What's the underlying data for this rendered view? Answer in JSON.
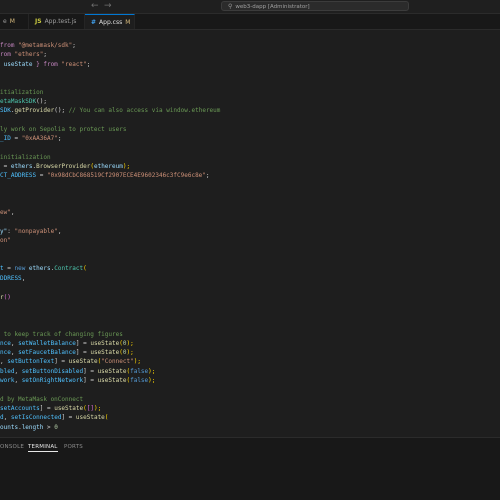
{
  "titlebar": {
    "back_icon": "arrow-left-icon",
    "forward_icon": "arrow-right-icon",
    "search_text": "web3-dapp [Administrator]"
  },
  "tabs": [
    {
      "label": "e",
      "modified": "M",
      "icon": "",
      "active": false
    },
    {
      "label": "App.test.js",
      "modified": "",
      "icon": "JS",
      "icon_color": "#cbcb41",
      "active": false
    },
    {
      "label": "App.css",
      "modified": "M",
      "icon": "#",
      "icon_color": "#42a5f5",
      "active": true
    }
  ],
  "code": {
    "l01": {
      "a": "from ",
      "b": "\"@metamask/sdk\"",
      "c": ";"
    },
    "l02": {
      "a": "rom ",
      "b": "\"ethers\"",
      "c": ";"
    },
    "l03": {
      "a": " useState ",
      "b": "} from ",
      "c": "\"react\"",
      "d": ";"
    },
    "l05": {
      "a": "itialization"
    },
    "l06": {
      "a": "etaMaskSDK",
      "b": "();"
    },
    "l07": {
      "a": "SDK",
      "b": ".",
      "c": "getProvider",
      "d": "(); ",
      "e": "// You can also access via window.ethereum"
    },
    "l09": {
      "a": "ly work on Sepolia to protect users"
    },
    "l10": {
      "a": "_ID",
      "b": " = ",
      "c": "\"0xAA36A7\"",
      "d": ";"
    },
    "l12": {
      "a": "initialization"
    },
    "l13": {
      "a": " = ",
      "b": "ethers",
      "c": ".",
      "d": "BrowserProvider",
      "e": "(",
      "f": "ethereum",
      "g": ");"
    },
    "l14": {
      "a": "CT_ADDRESS",
      "b": " = ",
      "c": "\"0x98dCbC868519Cf2907ECE4E9602346c3fC9e6c8e\"",
      "d": ";"
    },
    "l18": {
      "a": "ew\"",
      "b": ","
    },
    "l21": {
      "a": "y\"",
      "b": ": ",
      "c": "\"nonpayable\"",
      "d": ","
    },
    "l22": {
      "a": "on\""
    },
    "l25": {
      "a": "t",
      "b": " = ",
      "c": "new ",
      "d": "ethers",
      "e": ".",
      "f": "Contract",
      "g": "("
    },
    "l26": {
      "a": "DDRESS",
      "b": ","
    },
    "l29": {
      "a": "r",
      "b": "()"
    },
    "l33": {
      "a": " to keep track of changing figures"
    },
    "l34": {
      "a": "nce",
      "b": ", ",
      "c": "setWalletBalance",
      "d": "] = ",
      "e": "useState",
      "f": "(",
      "g": "0",
      "h": ");"
    },
    "l35": {
      "a": "nce",
      "b": ", ",
      "c": "setFaucetBalance",
      "d": "] = ",
      "e": "useState",
      "f": "(",
      "g": "0",
      "h": ");"
    },
    "l36": {
      "a": ", ",
      "b": "setButtonText",
      "c": "] = ",
      "d": "useState",
      "e": "(",
      "f": "\"Connect\"",
      "g": ");"
    },
    "l37": {
      "a": "bled",
      "b": ", ",
      "c": "setButtonDisabled",
      "d": "] = ",
      "e": "useState",
      "f": "(",
      "g": "false",
      "h": ");"
    },
    "l38": {
      "a": "work",
      "b": ", ",
      "c": "setOnRightNetwork",
      "d": "] = ",
      "e": "useState",
      "f": "(",
      "g": "false",
      "h": ");"
    },
    "l40": {
      "a": "d by MetaMask onConnect"
    },
    "l41": {
      "a": "setAccounts",
      "b": "] = ",
      "c": "useState",
      "d": "(",
      "e": "[]",
      "f": ");"
    },
    "l42": {
      "a": "d",
      "b": ", ",
      "c": "setIsConnected",
      "d": "] = ",
      "e": "useState",
      "f": "("
    },
    "l43": {
      "a": "ounts",
      "b": ".",
      "c": "length",
      "d": " > ",
      "e": "0"
    }
  },
  "panel": {
    "tabs": [
      "ONSOLE",
      "TERMINAL",
      "PORTS"
    ],
    "active": "TERMINAL"
  }
}
